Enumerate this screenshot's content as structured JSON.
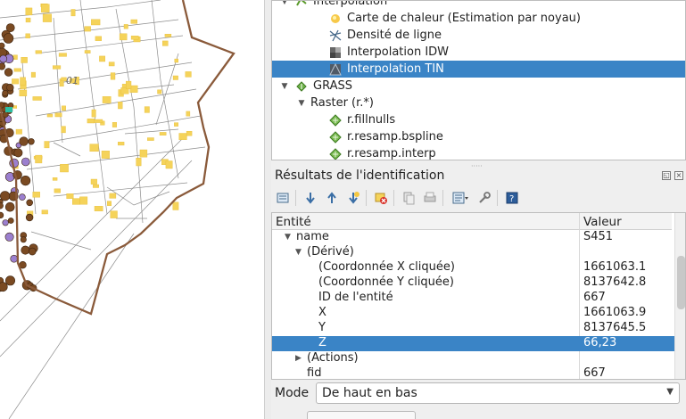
{
  "tree": {
    "items": [
      {
        "label": "Interpolation",
        "level": 0,
        "arrow": "▼",
        "icon": "interpolation-icon",
        "selected": false
      },
      {
        "label": "Carte de chaleur (Estimation par noyau)",
        "level": 2,
        "arrow": "",
        "icon": "heatmap-icon",
        "selected": false
      },
      {
        "label": "Densité de ligne",
        "level": 2,
        "arrow": "",
        "icon": "line-density-icon",
        "selected": false
      },
      {
        "label": "Interpolation IDW",
        "level": 2,
        "arrow": "",
        "icon": "idw-icon",
        "selected": false
      },
      {
        "label": "Interpolation TIN",
        "level": 2,
        "arrow": "",
        "icon": "tin-icon",
        "selected": true
      },
      {
        "label": "GRASS",
        "level": 0,
        "arrow": "▼",
        "icon": "grass-icon",
        "selected": false
      },
      {
        "label": "Raster (r.*)",
        "level": 1,
        "arrow": "▼",
        "icon": "",
        "selected": false
      },
      {
        "label": "r.fillnulls",
        "level": 2,
        "arrow": "",
        "icon": "grass-tool-icon",
        "selected": false
      },
      {
        "label": "r.resamp.bspline",
        "level": 2,
        "arrow": "",
        "icon": "grass-tool-icon",
        "selected": false
      },
      {
        "label": "r.resamp.interp",
        "level": 2,
        "arrow": "",
        "icon": "grass-tool-icon",
        "selected": false
      }
    ]
  },
  "identify": {
    "title": "Résultats de l'identification",
    "headers": {
      "entity": "Entité",
      "value": "Valeur"
    },
    "rows": [
      {
        "key": "name",
        "value": "S451",
        "level": 0,
        "arrow": "▼",
        "selected": false
      },
      {
        "key": "(Dérivé)",
        "value": "",
        "level": 1,
        "arrow": "▼",
        "selected": false
      },
      {
        "key": "(Coordonnée X cliquée)",
        "value": "1661063.1",
        "level": 2,
        "arrow": "",
        "selected": false
      },
      {
        "key": "(Coordonnée Y cliquée)",
        "value": "8137642.8",
        "level": 2,
        "arrow": "",
        "selected": false
      },
      {
        "key": "ID de l'entité",
        "value": "667",
        "level": 2,
        "arrow": "",
        "selected": false
      },
      {
        "key": "X",
        "value": "1661063.9",
        "level": 2,
        "arrow": "",
        "selected": false
      },
      {
        "key": "Y",
        "value": "8137645.5",
        "level": 2,
        "arrow": "",
        "selected": false
      },
      {
        "key": "Z",
        "value": "66,23",
        "level": 2,
        "arrow": "",
        "selected": true
      },
      {
        "key": "(Actions)",
        "value": "",
        "level": 1,
        "arrow": "▶",
        "selected": false
      },
      {
        "key": "fid",
        "value": "667",
        "level": 1,
        "arrow": "",
        "selected": false
      }
    ],
    "mode_label": "Mode",
    "mode_value": "De haut en bas",
    "toolbar_icons": [
      "expand-icon",
      "expand-all-icon",
      "collapse-all-icon",
      "expand-new-icon",
      "clear-results-icon",
      "copy-icon",
      "print-icon",
      "identify-settings-icon",
      "settings-icon",
      "help-icon"
    ]
  },
  "map": {
    "label_text": "01"
  },
  "colors": {
    "selection": "#3a84c6",
    "building": "#f5d35a",
    "boundary": "#8a5a3a",
    "point_brown": "#7a4a22",
    "point_purple": "#9b7fcf"
  }
}
